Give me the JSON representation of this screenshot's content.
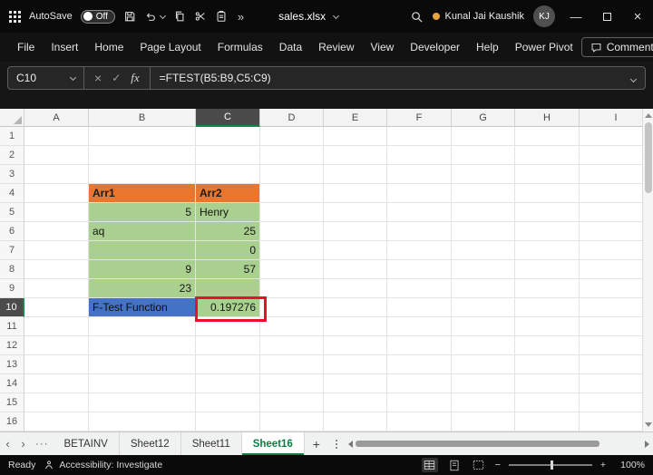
{
  "titlebar": {
    "autosave_label": "AutoSave",
    "autosave_state": "Off",
    "overflow_glyph": "»",
    "filename": "sales.xlsx",
    "user_name": "Kunal Jai Kaushik",
    "user_initials": "KJ",
    "minimize_glyph": "—",
    "close_glyph": "×"
  },
  "ribbon": {
    "tabs": [
      "File",
      "Insert",
      "Home",
      "Page Layout",
      "Formulas",
      "Data",
      "Review",
      "View",
      "Developer",
      "Help",
      "Power Pivot"
    ],
    "comments_label": "Comments"
  },
  "formula_bar": {
    "name_box_value": "C10",
    "cancel_glyph": "×",
    "enter_glyph": "✓",
    "fx_label": "fx",
    "formula": "=FTEST(B5:B9,C5:C9)"
  },
  "grid": {
    "column_headers": [
      "A",
      "B",
      "C",
      "D",
      "E",
      "F",
      "G",
      "H",
      "I"
    ],
    "row_headers": [
      "1",
      "2",
      "3",
      "4",
      "5",
      "6",
      "7",
      "8",
      "9",
      "10",
      "11",
      "12",
      "13",
      "14",
      "15",
      "16"
    ],
    "selected_cell": "C10",
    "cells": {
      "B4": "Arr1",
      "C4": "Arr2",
      "B5": "5",
      "C5": "Henry",
      "B6": "aq",
      "C6": "25",
      "C7": "0",
      "B8": "9",
      "C8": "57",
      "B9": "23",
      "B10": "F-Test Function",
      "C10": "0.197276"
    }
  },
  "sheet_bar": {
    "nav_left": "‹",
    "nav_right": "›",
    "more_tabs": "···",
    "tabs": [
      "BETAINV",
      "Sheet12",
      "Sheet11",
      "Sheet16"
    ],
    "active_tab": "Sheet16",
    "add_sheet": "+"
  },
  "status_bar": {
    "mode": "Ready",
    "accessibility": "Accessibility: Investigate",
    "zoom_out": "−",
    "zoom_in": "+",
    "zoom_level": "100%"
  },
  "colors": {
    "array_header_fill": "#E9762E",
    "array_fill": "#A9D08E",
    "label_fill": "#4472C4",
    "annotation_red": "#E8112D",
    "excel_green": "#0F7B40"
  }
}
